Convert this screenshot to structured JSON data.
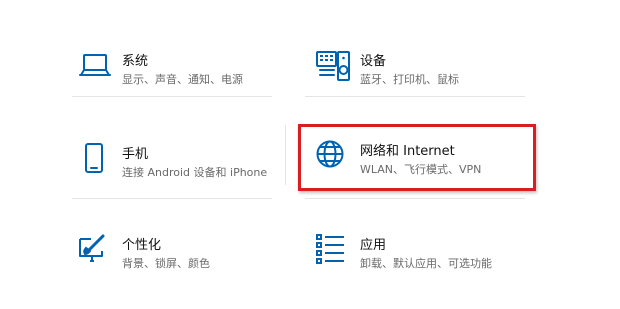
{
  "tiles": {
    "system": {
      "title": "系统",
      "desc": "显示、声音、通知、电源"
    },
    "devices": {
      "title": "设备",
      "desc": "蓝牙、打印机、鼠标"
    },
    "phone": {
      "title": "手机",
      "desc": "连接 Android 设备和 iPhone"
    },
    "network": {
      "title": "网络和 Internet",
      "desc": "WLAN、飞行模式、VPN"
    },
    "personalization": {
      "title": "个性化",
      "desc": "背景、锁屏、颜色"
    },
    "apps": {
      "title": "应用",
      "desc": "卸载、默认应用、可选功能"
    }
  },
  "icons": {
    "system": "laptop-icon",
    "devices": "keyboard-speaker-icon",
    "phone": "phone-icon",
    "network": "globe-icon",
    "personalization": "paint-brush-icon",
    "apps": "apps-list-icon"
  },
  "colors": {
    "accent": "#0063b1",
    "highlight": "#d81e1e"
  }
}
